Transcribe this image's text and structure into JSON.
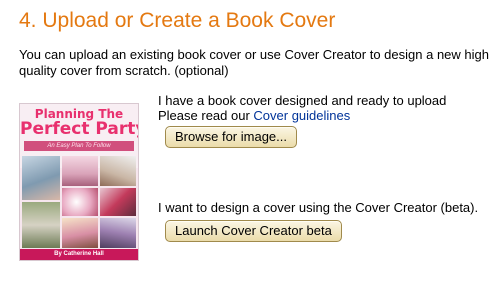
{
  "section": {
    "title": "4. Upload or Create a Book Cover",
    "intro_line1": "You can upload an existing book cover or use Cover Creator to design a new high",
    "intro_line2": "quality cover from scratch. (optional)"
  },
  "cover_preview": {
    "title_line1": "Planning The",
    "title_line2": "Perfect Party",
    "subtitle": "An Easy Plan To Follow",
    "author": "By Catherine Hall"
  },
  "upload_option": {
    "line1": "I have a book cover designed and ready to upload",
    "line2_prefix": "Please read our ",
    "guidelines_link": "Cover guidelines",
    "browse_button": "Browse for image..."
  },
  "creator_option": {
    "text": "I want to design a cover using the Cover Creator (beta).",
    "launch_button": "Launch Cover Creator beta"
  },
  "colors": {
    "heading": "#e47911",
    "link": "#003399",
    "button_border": "#a08a4c"
  }
}
